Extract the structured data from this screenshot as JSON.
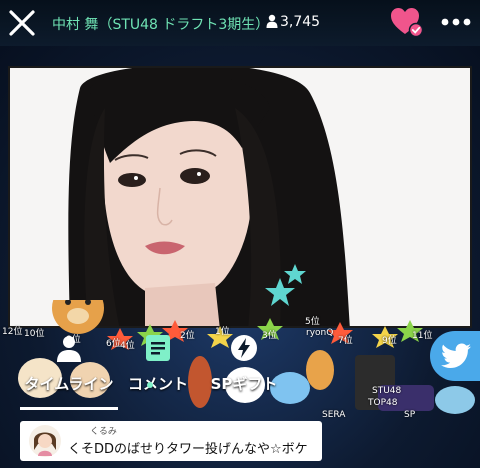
{
  "header": {
    "streamer_name": "中村 舞（STU48 ドラフト3期生）",
    "viewer_count": "3,745",
    "icons": [
      "close-icon",
      "person-icon",
      "heart-check-icon",
      "more-icon"
    ],
    "accent_color": "#6fe3b4",
    "heart_color": "#f0558c"
  },
  "gift_ranks": [
    "12位",
    "10位",
    "8位",
    "6位",
    "4位",
    "2位",
    "1位",
    "3位",
    "5位",
    "7位",
    "9位",
    "11位"
  ],
  "gift_labels": [
    "ryonQ",
    "STU48",
    "TOP48",
    "SERA",
    "SP"
  ],
  "tabs": [
    {
      "label": "タイムライン",
      "icon": "person-icon",
      "selected": true
    },
    {
      "label": "コメント",
      "icon": "comment-icon",
      "selected": false
    },
    {
      "label": "SPギフト",
      "icon": "lightning-icon",
      "selected": false
    }
  ],
  "comment": {
    "username": "くるみ",
    "text": "くそDDのばせりタワー投げんなや☆ボケ"
  },
  "share": {
    "icon": "twitter-icon",
    "color": "#4aa9ea"
  }
}
